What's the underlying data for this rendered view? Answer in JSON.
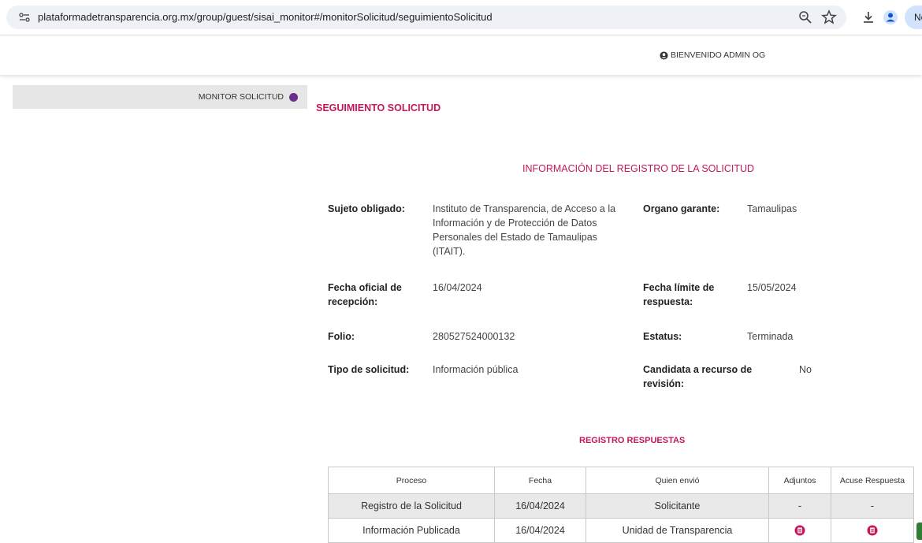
{
  "browser": {
    "url": "plataformadetransparencia.org.mx/group/guest/sisai_monitor#/monitorSolicitud/seguimientoSolicitud",
    "profile_badge": "Nc"
  },
  "header": {
    "welcome": "BIENVENIDO ADMIN OG"
  },
  "sidebar": {
    "items": [
      {
        "label": "MONITOR SOLICITUD"
      }
    ]
  },
  "main": {
    "page_title": "SEGUIMIENTO SOLICITUD",
    "info_title": "INFORMACIÓN DEL REGISTRO DE LA SOLICITUD",
    "fields": {
      "sujeto_label": "Sujeto obligado:",
      "sujeto_value": "Instituto de Transparencia, de Acceso a la Información y de Protección de Datos Personales del Estado de Tamaulipas (ITAIT).",
      "organo_label": "Organo garante:",
      "organo_value": "Tamaulipas",
      "fecha_oficial_label": "Fecha oficial de recepción:",
      "fecha_oficial_value": "16/04/2024",
      "fecha_limite_label": "Fecha límite de respuesta:",
      "fecha_limite_value": "15/05/2024",
      "folio_label": "Folio:",
      "folio_value": "280527524000132",
      "estatus_label": "Estatus:",
      "estatus_value": "Terminada",
      "tipo_label": "Tipo de solicitud:",
      "tipo_value": "Información pública",
      "candidata_label": "Candidata a recurso de revisión:",
      "candidata_value": "No"
    },
    "responses_title": "REGISTRO RESPUESTAS",
    "table": {
      "headers": [
        "Proceso",
        "Fecha",
        "Quien envió",
        "Adjuntos",
        "Acuse Respuesta"
      ],
      "rows": [
        {
          "proceso": "Registro de la Solicitud",
          "fecha": "16/04/2024",
          "quien": "Solicitante",
          "adjuntos": "-",
          "acuse": "-"
        },
        {
          "proceso": "Información Publicada",
          "fecha": "16/04/2024",
          "quien": "Unidad de Transparencia",
          "adjuntos_icon": "document-icon",
          "acuse_icon": "document-icon"
        }
      ]
    }
  },
  "colors": {
    "accent": "#c2185b",
    "sidebar_dot": "#6b2e8c",
    "row_gray": "#e9e9e9"
  }
}
